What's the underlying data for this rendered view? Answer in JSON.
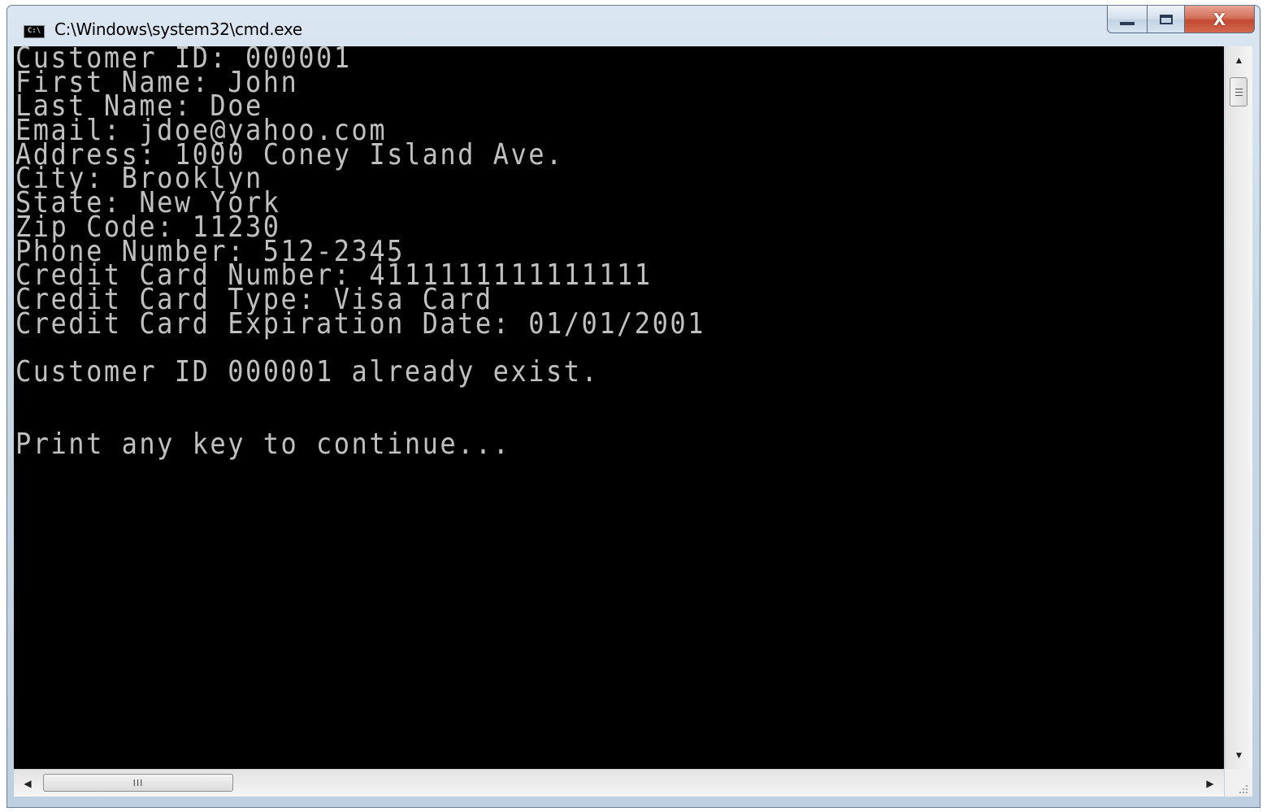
{
  "window": {
    "title": "C:\\Windows\\system32\\cmd.exe",
    "app_icon_label": "C:\\",
    "icon": "cmd-icon",
    "controls": {
      "minimize_icon": "minimize-icon",
      "maximize_icon": "maximize-icon",
      "close_label": "X"
    }
  },
  "console": {
    "lines": [
      "Customer ID: 000001",
      "First Name: John",
      "Last Name: Doe",
      "Email: jdoe@yahoo.com",
      "Address: 1000 Coney Island Ave.",
      "City: Brooklyn",
      "State: New York",
      "Zip Code: 11230",
      "Phone Number: 512-2345",
      "Credit Card Number: 4111111111111111",
      "Credit Card Type: Visa Card",
      "Credit Card Expiration Date: 01/01/2001",
      "",
      "Customer ID 000001 already exist.",
      "",
      "",
      "Print any key to continue..."
    ],
    "text_color": "#c0c0c0",
    "background_color": "#000000"
  },
  "scrollbars": {
    "vertical": {
      "up_icon": "scroll-up-arrow-icon",
      "down_icon": "scroll-down-arrow-icon"
    },
    "horizontal": {
      "left_icon": "scroll-left-arrow-icon",
      "right_icon": "scroll-right-arrow-icon",
      "thumb_grip": "III"
    }
  }
}
